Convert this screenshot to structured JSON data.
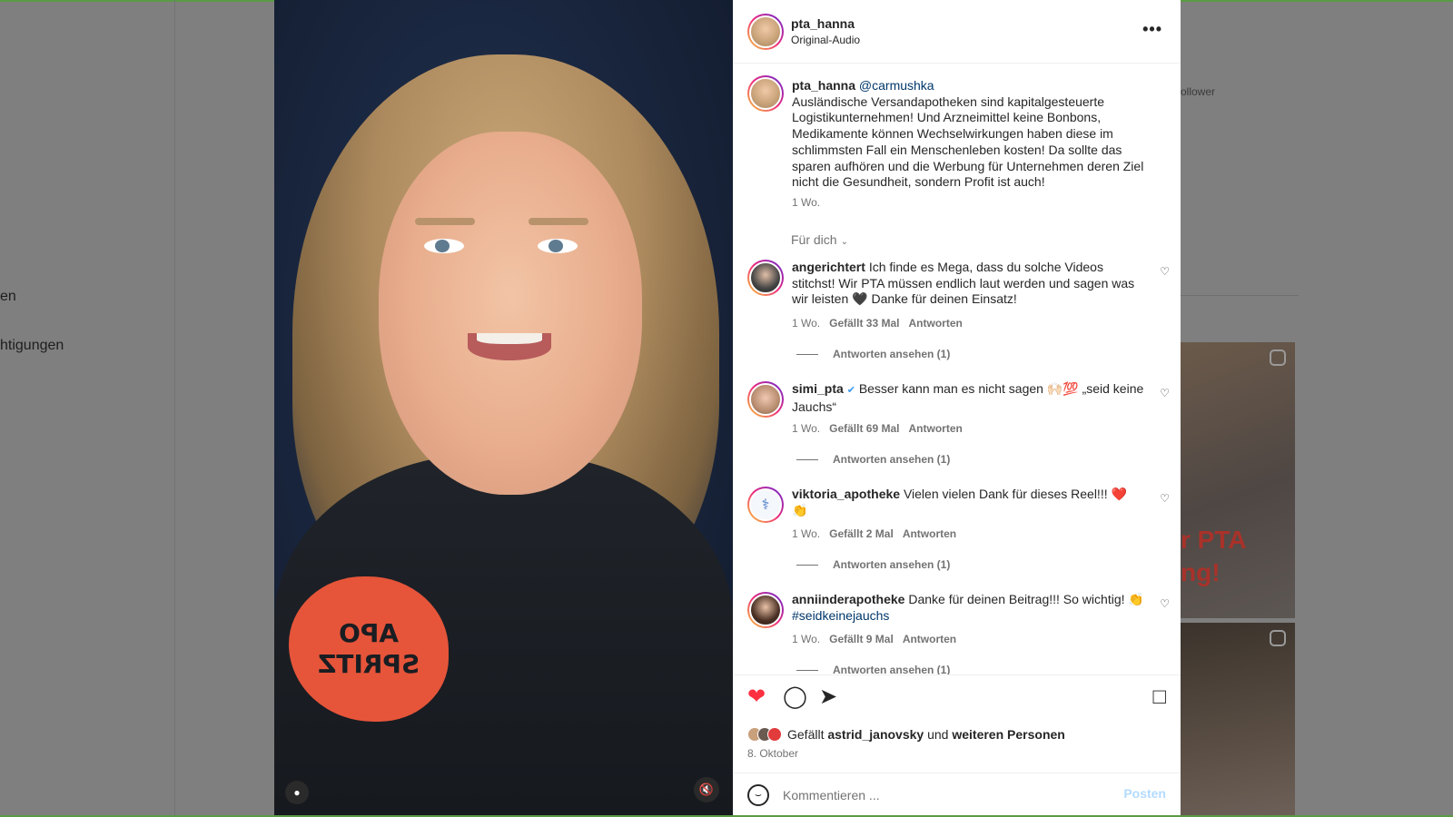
{
  "background": {
    "nav_items": [
      "en",
      "htigungen"
    ],
    "follower_text": "ollower",
    "thumb_text_1": "r PTA",
    "thumb_text_2": "ng!"
  },
  "video": {
    "shirt_text_line1": "APO",
    "shirt_text_line2": "SPRITZ"
  },
  "post": {
    "author": "pta_hanna",
    "audio": "Original-Audio",
    "caption": {
      "author": "pta_hanna",
      "mention": "@carmushka",
      "text": "Ausländische Versandapotheken sind kapitalgesteuerte Logistikunternehmen! Und Arzneimittel keine Bonbons, Medikamente können Wechselwirkungen haben diese im schlimmsten Fall ein Menschenleben kosten! Da sollte das sparen aufhören und die Werbung für Unternehmen deren Ziel nicht die Gesundheit, sondern Profit ist auch!",
      "time": "1 Wo."
    },
    "sort_label": "Für dich",
    "comments": [
      {
        "user": "angerichtert",
        "text": "Ich finde es Mega, dass du solche Videos stitchst! Wir PTA müssen endlich laut werden und sagen was wir leisten 🖤 Danke für deinen Einsatz!",
        "time": "1 Wo.",
        "likes": "Gefällt 33 Mal",
        "reply": "Antworten",
        "view_replies": "Antworten ansehen (1)"
      },
      {
        "user": "simi_pta",
        "verified": "✔",
        "text": "Besser kann man es nicht sagen 🙌🏻💯 „seid keine Jauchs“",
        "time": "1 Wo.",
        "likes": "Gefällt 69 Mal",
        "reply": "Antworten",
        "view_replies": "Antworten ansehen (1)"
      },
      {
        "user": "viktoria_apotheke",
        "text": "Vielen vielen Dank für dieses Reel!!! ❤️ 👏",
        "time": "1 Wo.",
        "likes": "Gefällt 2 Mal",
        "reply": "Antworten",
        "view_replies": "Antworten ansehen (1)"
      },
      {
        "user": "anniinderapotheke",
        "text": "Danke für deinen Beitrag!!! So wichtig! 👏",
        "hashtag": "#seidkeinejauchs",
        "time": "1 Wo.",
        "likes": "Gefällt 9 Mal",
        "reply": "Antworten",
        "view_replies": "Antworten ansehen (1)"
      }
    ],
    "liked_by_prefix": "Gefällt",
    "liked_by_user": "astrid_janovsky",
    "liked_by_and": "und",
    "liked_by_others": "weiteren Personen",
    "date": "8. Oktober",
    "comment_placeholder": "Kommentieren ...",
    "post_label": "Posten"
  },
  "icons": {
    "more": "more-options-icon",
    "like": "heart-icon",
    "comment": "comment-icon",
    "share": "share-icon",
    "save": "bookmark-icon",
    "emoji": "emoji-icon",
    "mute": "mute-icon",
    "user": "user-tag-icon"
  },
  "colors": {
    "like_red": "#ff3040",
    "link_blue": "#00376b",
    "post_disabled": "#b3dbff",
    "verified_blue": "#3897f0"
  }
}
